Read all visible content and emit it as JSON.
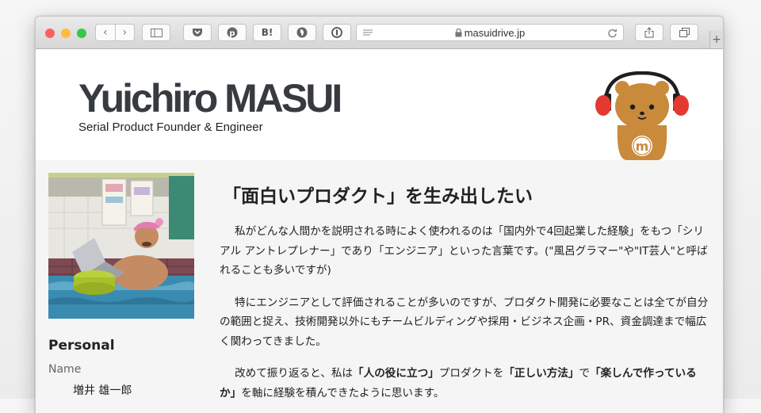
{
  "browser": {
    "url": "masuidrive.jp",
    "icons": [
      "back-icon",
      "forward-icon",
      "sidebar-icon",
      "pocket-icon",
      "pinterest-icon",
      "hatena-bookmark-icon",
      "evernote-icon",
      "onepassword-icon",
      "reader-icon",
      "lock-icon",
      "reload-icon",
      "share-icon",
      "tabs-icon",
      "new-tab-icon"
    ],
    "traffic_light_colors": [
      "#fc605b",
      "#fdbc40",
      "#34c84a"
    ],
    "bookmark_hatena_label": "B!",
    "new_tab_label": "+"
  },
  "site": {
    "title": "Yuichiro MASUI",
    "subtitle": "Serial Product Founder & Engineer",
    "mascot_letter": "m"
  },
  "sidebar": {
    "section_title": "Personal",
    "name_label": "Name",
    "name_value": "増井 雄一郎"
  },
  "article": {
    "heading": "「面白いプロダクト」を生み出したい",
    "p1": "私がどんな人間かを説明される時によく使われるのは「国内外で4回起業した経験」をもつ「シリアル アントレプレナー」であり「エンジニア」といった言葉です。(\"風呂グラマー\"や\"IT芸人\"と呼ばれることも多いですが)",
    "p2": "特にエンジニアとして評価されることが多いのですが、プロダクト開発に必要なことは全てが自分の範囲と捉え、技術開発以外にもチームビルディングや採用・ビジネス企画・PR、資金調達まで幅広く関わってきました。",
    "p3": {
      "a": "改めて振り返ると、私は",
      "b": "「人の役に立つ」",
      "c": "プロダクトを",
      "d": "「正しい方法」",
      "e": "で",
      "f": "「楽しんで作っているか」",
      "g": "を軸に経験を積んできたように思います。"
    }
  },
  "colors": {
    "title": "#373b40",
    "content_bg": "#f5f5f5",
    "mascot_brown": "#c98a3c",
    "headphone_red": "#e23a31"
  }
}
